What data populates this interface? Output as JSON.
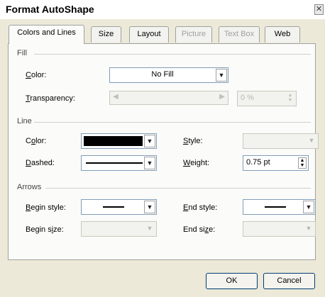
{
  "dialog": {
    "title": "Format AutoShape",
    "close_glyph": "✕"
  },
  "tabs": [
    {
      "label": "Colors and Lines",
      "state": "active"
    },
    {
      "label": "Size",
      "state": "normal"
    },
    {
      "label": "Layout",
      "state": "normal"
    },
    {
      "label": "Picture",
      "state": "disabled"
    },
    {
      "label": "Text Box",
      "state": "disabled"
    },
    {
      "label": "Web",
      "state": "normal"
    }
  ],
  "fill": {
    "group_label": "Fill",
    "color_label_pre": "",
    "color_label_key": "C",
    "color_label_post": "olor:",
    "color_value": "No Fill",
    "transparency_label_pre": "",
    "transparency_label_key": "T",
    "transparency_label_post": "ransparency:",
    "transparency_value": "0 %"
  },
  "line": {
    "group_label": "Line",
    "color_label_pre": "C",
    "color_label_key": "o",
    "color_label_post": "lor:",
    "color_swatch": "#000000",
    "style_label_pre": "",
    "style_label_key": "S",
    "style_label_post": "tyle:",
    "dashed_label_pre": "",
    "dashed_label_key": "D",
    "dashed_label_post": "ashed:",
    "weight_label_pre": "",
    "weight_label_key": "W",
    "weight_label_post": "eight:",
    "weight_value": "0.75 pt"
  },
  "arrows": {
    "group_label": "Arrows",
    "begin_style_label_pre": "",
    "begin_style_label_key": "B",
    "begin_style_label_post": "egin style:",
    "end_style_label_pre": "",
    "end_style_label_key": "E",
    "end_style_label_post": "nd style:",
    "begin_size_label_pre": "Begin s",
    "begin_size_label_key": "i",
    "begin_size_label_post": "ze:",
    "end_size_label_pre": "End si",
    "end_size_label_key": "z",
    "end_size_label_post": "e:"
  },
  "buttons": {
    "ok": "OK",
    "cancel": "Cancel"
  },
  "icons": {
    "dropdown": "chevron-down",
    "spin": "up-down-spinner"
  }
}
